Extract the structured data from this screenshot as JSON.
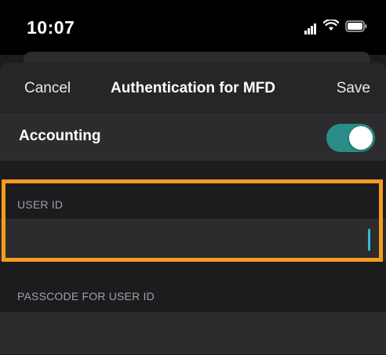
{
  "status_bar": {
    "time": "10:07",
    "icons": [
      "signal-icon",
      "wifi-icon",
      "battery-icon"
    ]
  },
  "nav": {
    "cancel_label": "Cancel",
    "title": "Authentication for MFD",
    "save_label": "Save"
  },
  "accounting": {
    "label": "Accounting",
    "enabled": true
  },
  "fields": [
    {
      "header": "USER ID",
      "value": "",
      "focused": true
    },
    {
      "header": "PASSCODE FOR USER ID",
      "value": "",
      "focused": false
    }
  ],
  "colors": {
    "background": "#1c1c1e",
    "cell": "#2c2c2e",
    "toggle_on": "#2a8d88",
    "caret": "#34b8d8",
    "highlight": "#f59c1e"
  }
}
